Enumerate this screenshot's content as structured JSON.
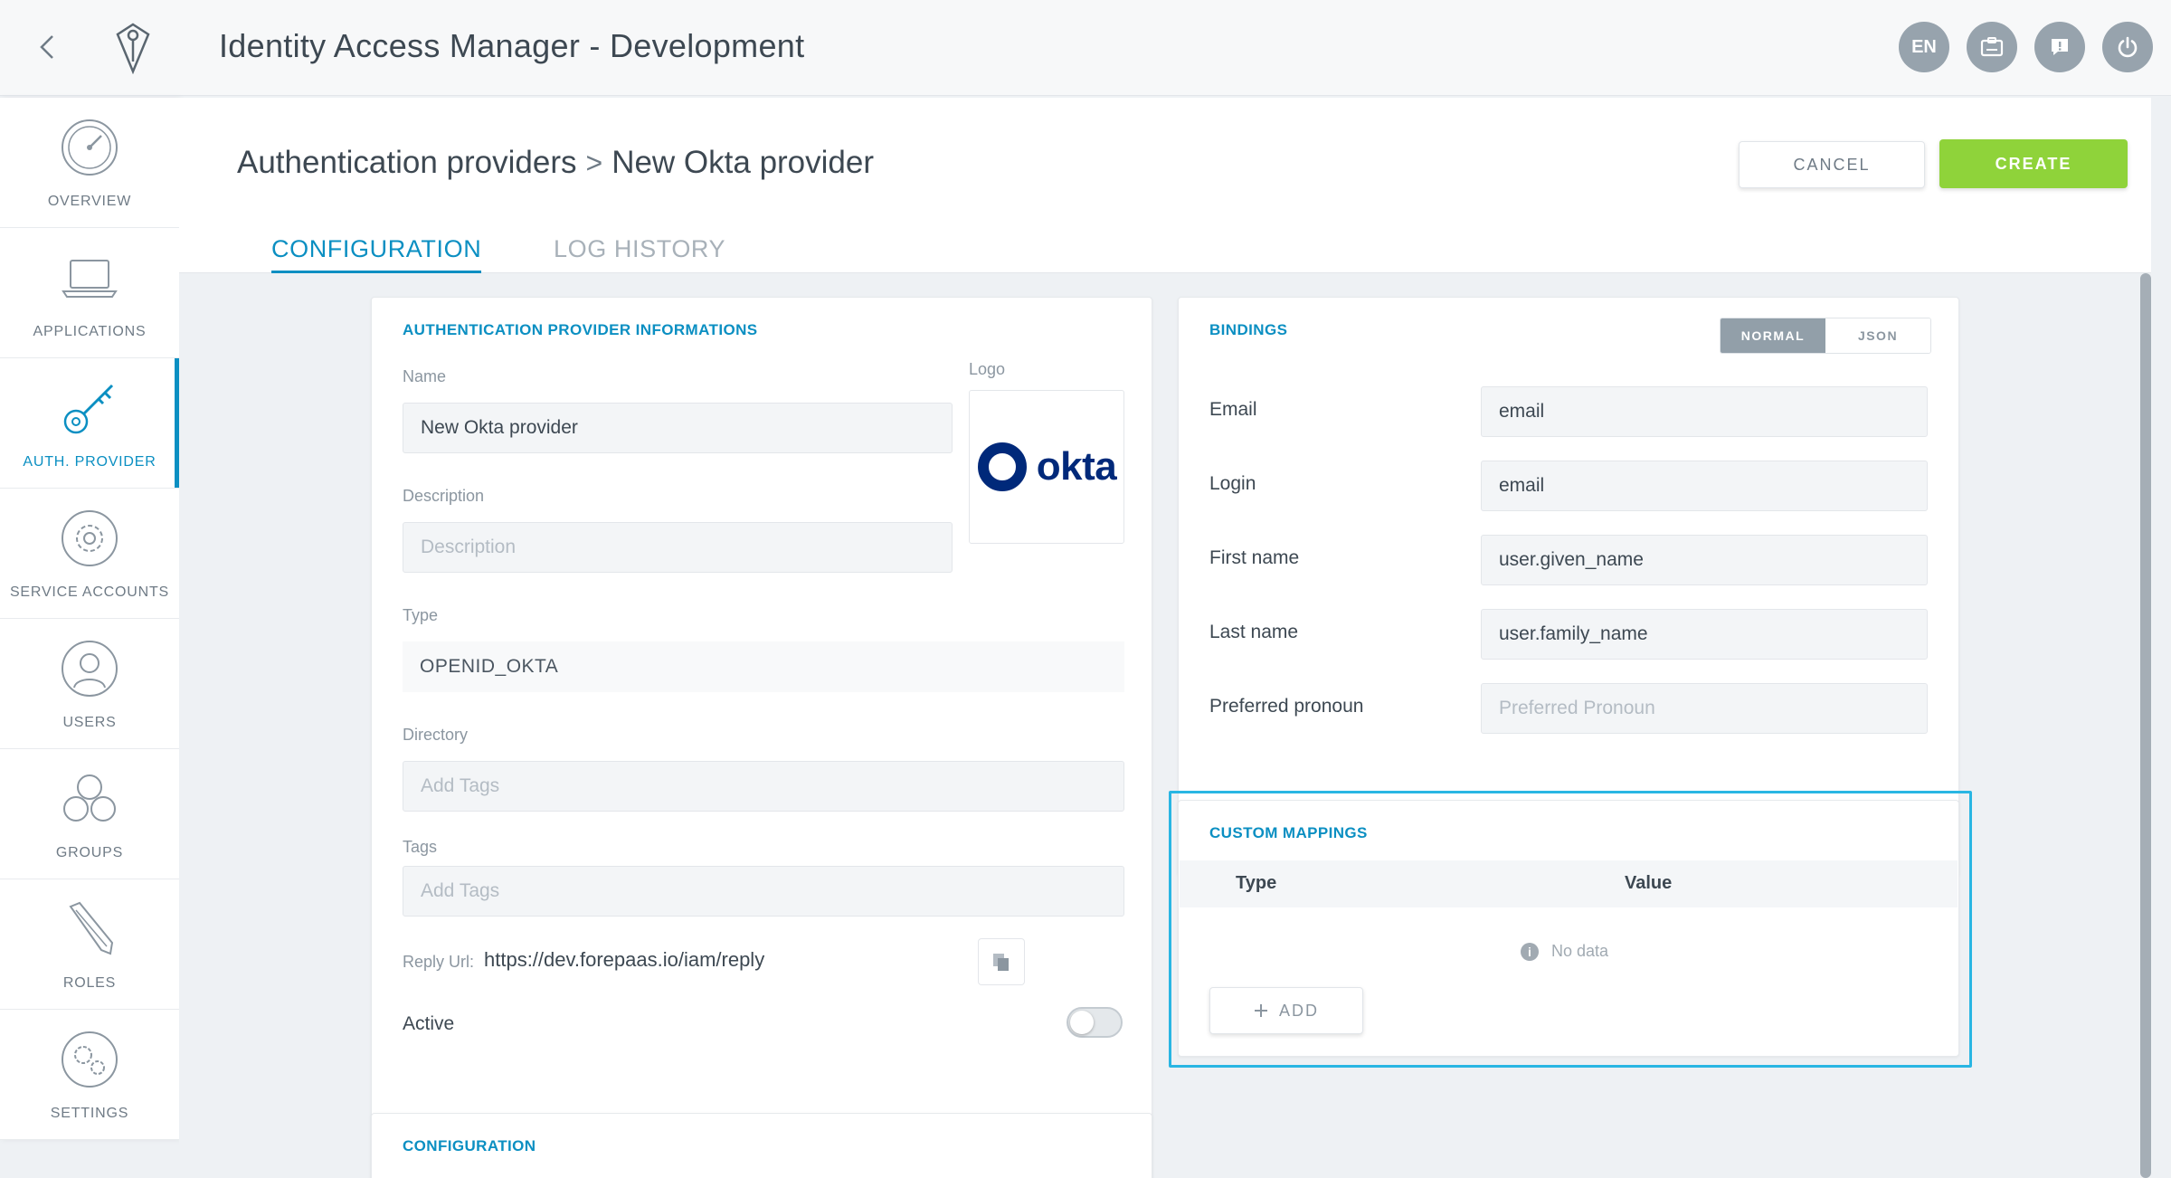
{
  "app": {
    "title": "Identity Access Manager - Development"
  },
  "top_actions": {
    "language": "EN"
  },
  "sidebar": {
    "items": [
      {
        "label": "OVERVIEW",
        "icon": "gauge-icon"
      },
      {
        "label": "APPLICATIONS",
        "icon": "laptop-icon"
      },
      {
        "label": "AUTH. PROVIDER",
        "icon": "key-icon",
        "active": true
      },
      {
        "label": "SERVICE ACCOUNTS",
        "icon": "gear-badge-icon"
      },
      {
        "label": "USERS",
        "icon": "user-icon"
      },
      {
        "label": "GROUPS",
        "icon": "group-icon"
      },
      {
        "label": "ROLES",
        "icon": "pencil-icon"
      },
      {
        "label": "SETTINGS",
        "icon": "gears-icon"
      }
    ]
  },
  "header": {
    "breadcrumb_root": "Authentication providers",
    "breadcrumb_sep": ">",
    "breadcrumb_current": "New Okta provider",
    "cancel_label": "CANCEL",
    "create_label": "CREATE"
  },
  "tabs": [
    {
      "label": "CONFIGURATION",
      "active": true
    },
    {
      "label": "LOG HISTORY",
      "active": false
    }
  ],
  "provider_info": {
    "title": "AUTHENTICATION PROVIDER INFORMATIONS",
    "name_label": "Name",
    "name_value": "New Okta provider",
    "logo_label": "Logo",
    "logo_text": "okta",
    "description_label": "Description",
    "description_placeholder": "Description",
    "type_label": "Type",
    "type_value": "OPENID_OKTA",
    "directory_label": "Directory",
    "directory_placeholder": "Add Tags",
    "tags_label": "Tags",
    "tags_placeholder": "Add Tags",
    "reply_url_label": "Reply Url:",
    "reply_url_value": "https://dev.forepaas.io/iam/reply",
    "active_label": "Active",
    "active_on": false
  },
  "configuration_card": {
    "title": "CONFIGURATION"
  },
  "bindings": {
    "title": "BINDINGS",
    "mode_options": [
      "NORMAL",
      "JSON"
    ],
    "mode_selected": "NORMAL",
    "rows": [
      {
        "label": "Email",
        "value": "email",
        "placeholder": ""
      },
      {
        "label": "Login",
        "value": "email",
        "placeholder": ""
      },
      {
        "label": "First name",
        "value": "user.given_name",
        "placeholder": ""
      },
      {
        "label": "Last name",
        "value": "user.family_name",
        "placeholder": ""
      },
      {
        "label": "Preferred pronoun",
        "value": "",
        "placeholder": "Preferred Pronoun"
      }
    ]
  },
  "custom_mappings": {
    "title": "CUSTOM MAPPINGS",
    "columns": [
      "Type",
      "Value"
    ],
    "empty_text": "No data",
    "add_label": "ADD"
  },
  "colors": {
    "accent": "#0b8fc2",
    "create": "#8fd33a",
    "highlight": "#29b6e3",
    "okta": "#00297a"
  }
}
